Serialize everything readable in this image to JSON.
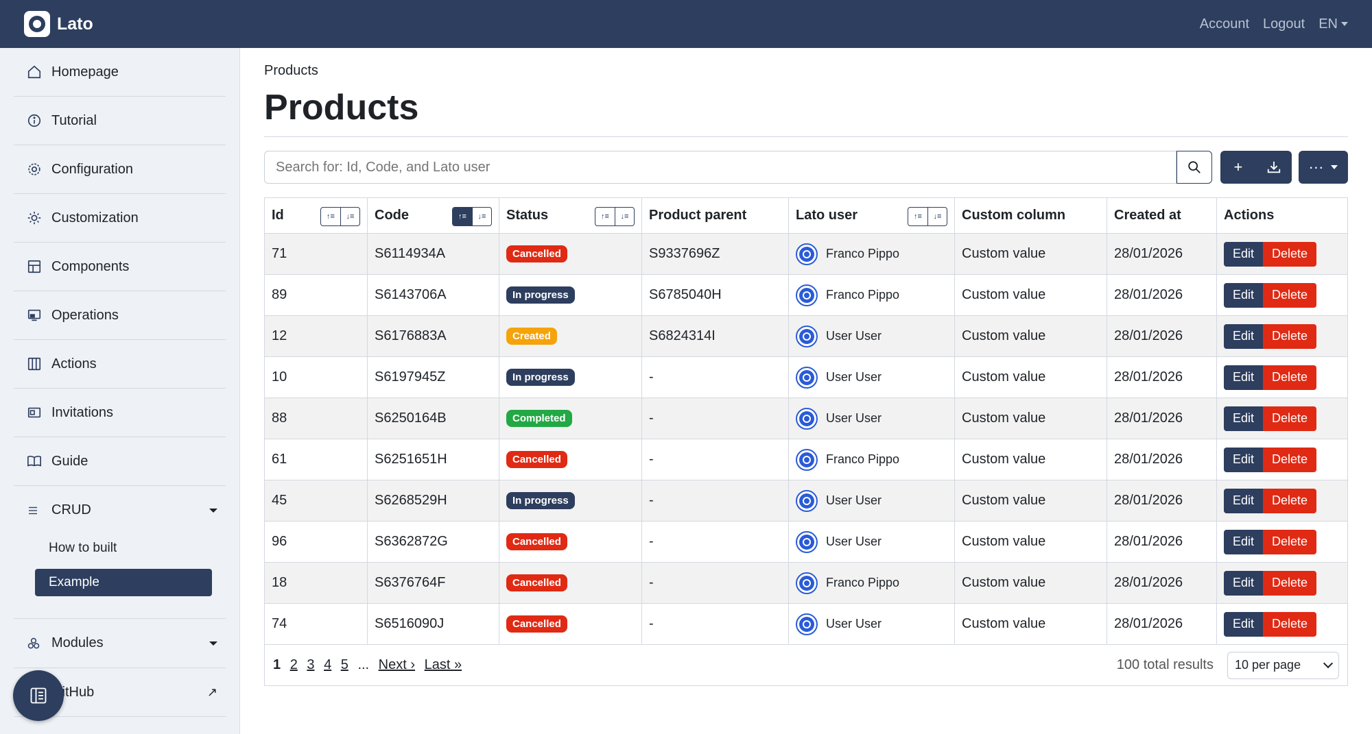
{
  "navbar": {
    "brand": "Lato",
    "links": {
      "account": "Account",
      "logout": "Logout",
      "lang": "EN"
    }
  },
  "sidebar": {
    "items": [
      {
        "label": "Homepage",
        "icon": "home-icon"
      },
      {
        "label": "Tutorial",
        "icon": "info-icon"
      },
      {
        "label": "Configuration",
        "icon": "gear-icon"
      },
      {
        "label": "Customization",
        "icon": "sun-icon"
      },
      {
        "label": "Components",
        "icon": "layout-icon"
      },
      {
        "label": "Operations",
        "icon": "monitor-icon"
      },
      {
        "label": "Actions",
        "icon": "columns-icon"
      },
      {
        "label": "Invitations",
        "icon": "envelope-icon"
      },
      {
        "label": "Guide",
        "icon": "book-icon"
      }
    ],
    "crud": {
      "label": "CRUD",
      "children": [
        "How to built",
        "Example"
      ]
    },
    "modules": {
      "label": "Modules"
    },
    "github": {
      "label": "GitHub"
    }
  },
  "main": {
    "breadcrumb": "Products",
    "title": "Products",
    "search": {
      "placeholder": "Search for: Id, Code, and Lato user"
    },
    "buttons": {
      "add": "+",
      "more": "···"
    }
  },
  "table": {
    "headers": [
      "Id",
      "Code",
      "Status",
      "Product parent",
      "Lato user",
      "Custom column",
      "Created at",
      "Actions"
    ],
    "rows": [
      {
        "id": "71",
        "code": "S6114934A",
        "status": "Cancelled",
        "status_color": "#e02a14",
        "parent": "S9337696Z",
        "user": "Franco Pippo",
        "custom": "Custom value",
        "created": "28/01/2026"
      },
      {
        "id": "89",
        "code": "S6143706A",
        "status": "In progress",
        "status_color": "#2d3e5e",
        "parent": "S6785040H",
        "user": "Franco Pippo",
        "custom": "Custom value",
        "created": "28/01/2026"
      },
      {
        "id": "12",
        "code": "S6176883A",
        "status": "Created",
        "status_color": "#f5a30a",
        "parent": "S6824314I",
        "user": "User User",
        "custom": "Custom value",
        "created": "28/01/2026"
      },
      {
        "id": "10",
        "code": "S6197945Z",
        "status": "In progress",
        "status_color": "#2d3e5e",
        "parent": "-",
        "user": "User User",
        "custom": "Custom value",
        "created": "28/01/2026"
      },
      {
        "id": "88",
        "code": "S6250164B",
        "status": "Completed",
        "status_color": "#22a845",
        "parent": "-",
        "user": "User User",
        "custom": "Custom value",
        "created": "28/01/2026"
      },
      {
        "id": "61",
        "code": "S6251651H",
        "status": "Cancelled",
        "status_color": "#e02a14",
        "parent": "-",
        "user": "Franco Pippo",
        "custom": "Custom value",
        "created": "28/01/2026"
      },
      {
        "id": "45",
        "code": "S6268529H",
        "status": "In progress",
        "status_color": "#2d3e5e",
        "parent": "-",
        "user": "User User",
        "custom": "Custom value",
        "created": "28/01/2026"
      },
      {
        "id": "96",
        "code": "S6362872G",
        "status": "Cancelled",
        "status_color": "#e02a14",
        "parent": "-",
        "user": "User User",
        "custom": "Custom value",
        "created": "28/01/2026"
      },
      {
        "id": "18",
        "code": "S6376764F",
        "status": "Cancelled",
        "status_color": "#e02a14",
        "parent": "-",
        "user": "Franco Pippo",
        "custom": "Custom value",
        "created": "28/01/2026"
      },
      {
        "id": "74",
        "code": "S6516090J",
        "status": "Cancelled",
        "status_color": "#e02a14",
        "parent": "-",
        "user": "User User",
        "custom": "Custom value",
        "created": "28/01/2026"
      }
    ],
    "edit_label": "Edit",
    "delete_label": "Delete"
  },
  "pagination": {
    "current": "1",
    "pages": [
      "2",
      "3",
      "4",
      "5"
    ],
    "ellipsis": "...",
    "next": "Next ›",
    "last": "Last »",
    "total": "100 total results",
    "per_page": "10 per page"
  },
  "colors": {
    "primary": "#2d3e5e",
    "danger": "#e02a14",
    "warning": "#f5a30a",
    "success": "#22a845"
  }
}
